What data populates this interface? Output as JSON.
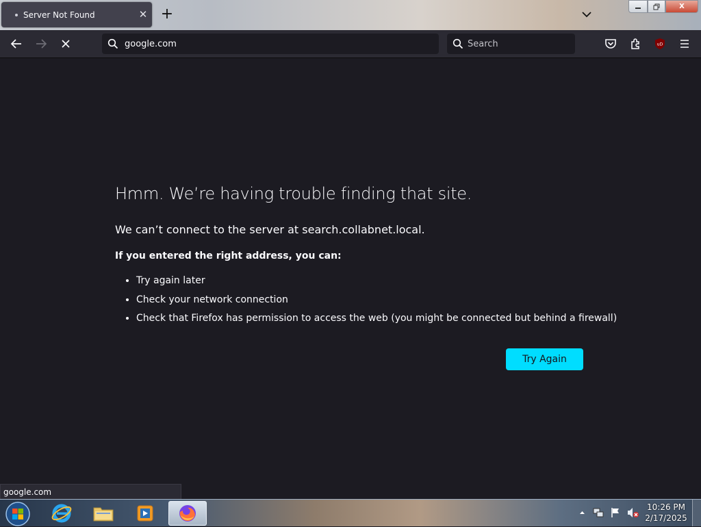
{
  "tab": {
    "title": "Server Not Found",
    "close_icon": "close-icon",
    "new_tab_label": "+"
  },
  "window_controls": {
    "minimize_icon": "minimize-icon",
    "maximize_icon": "restore-icon",
    "close_label": "X"
  },
  "navbar": {
    "back_icon": "arrow-left-icon",
    "forward_icon": "arrow-right-icon",
    "stop_icon": "stop-icon",
    "url": "google.com",
    "search_placeholder": "Search",
    "toolbar_icons": [
      "pocket-icon",
      "extensions-icon",
      "ublock-icon",
      "menu-icon"
    ]
  },
  "error_page": {
    "title": "Hmm. We’re having trouble finding that site.",
    "description": "We can’t connect to the server at search.collabnet.local.",
    "subheading": "If you entered the right address, you can:",
    "suggestions": [
      "Try again later",
      "Check your network connection",
      "Check that Firefox has permission to access the web (you might be connected but behind a firewall)"
    ],
    "try_again_label": "Try Again",
    "accent_color": "#00ddff"
  },
  "status": {
    "text": "google.com"
  },
  "taskbar": {
    "apps": [
      "internet-explorer-icon",
      "file-explorer-icon",
      "media-player-icon",
      "firefox-icon"
    ],
    "tray_icons": [
      "show-hidden-icon",
      "network-icon",
      "action-center-flag-icon",
      "volume-muted-icon"
    ],
    "time": "10:26 PM",
    "date": "2/17/2025"
  }
}
